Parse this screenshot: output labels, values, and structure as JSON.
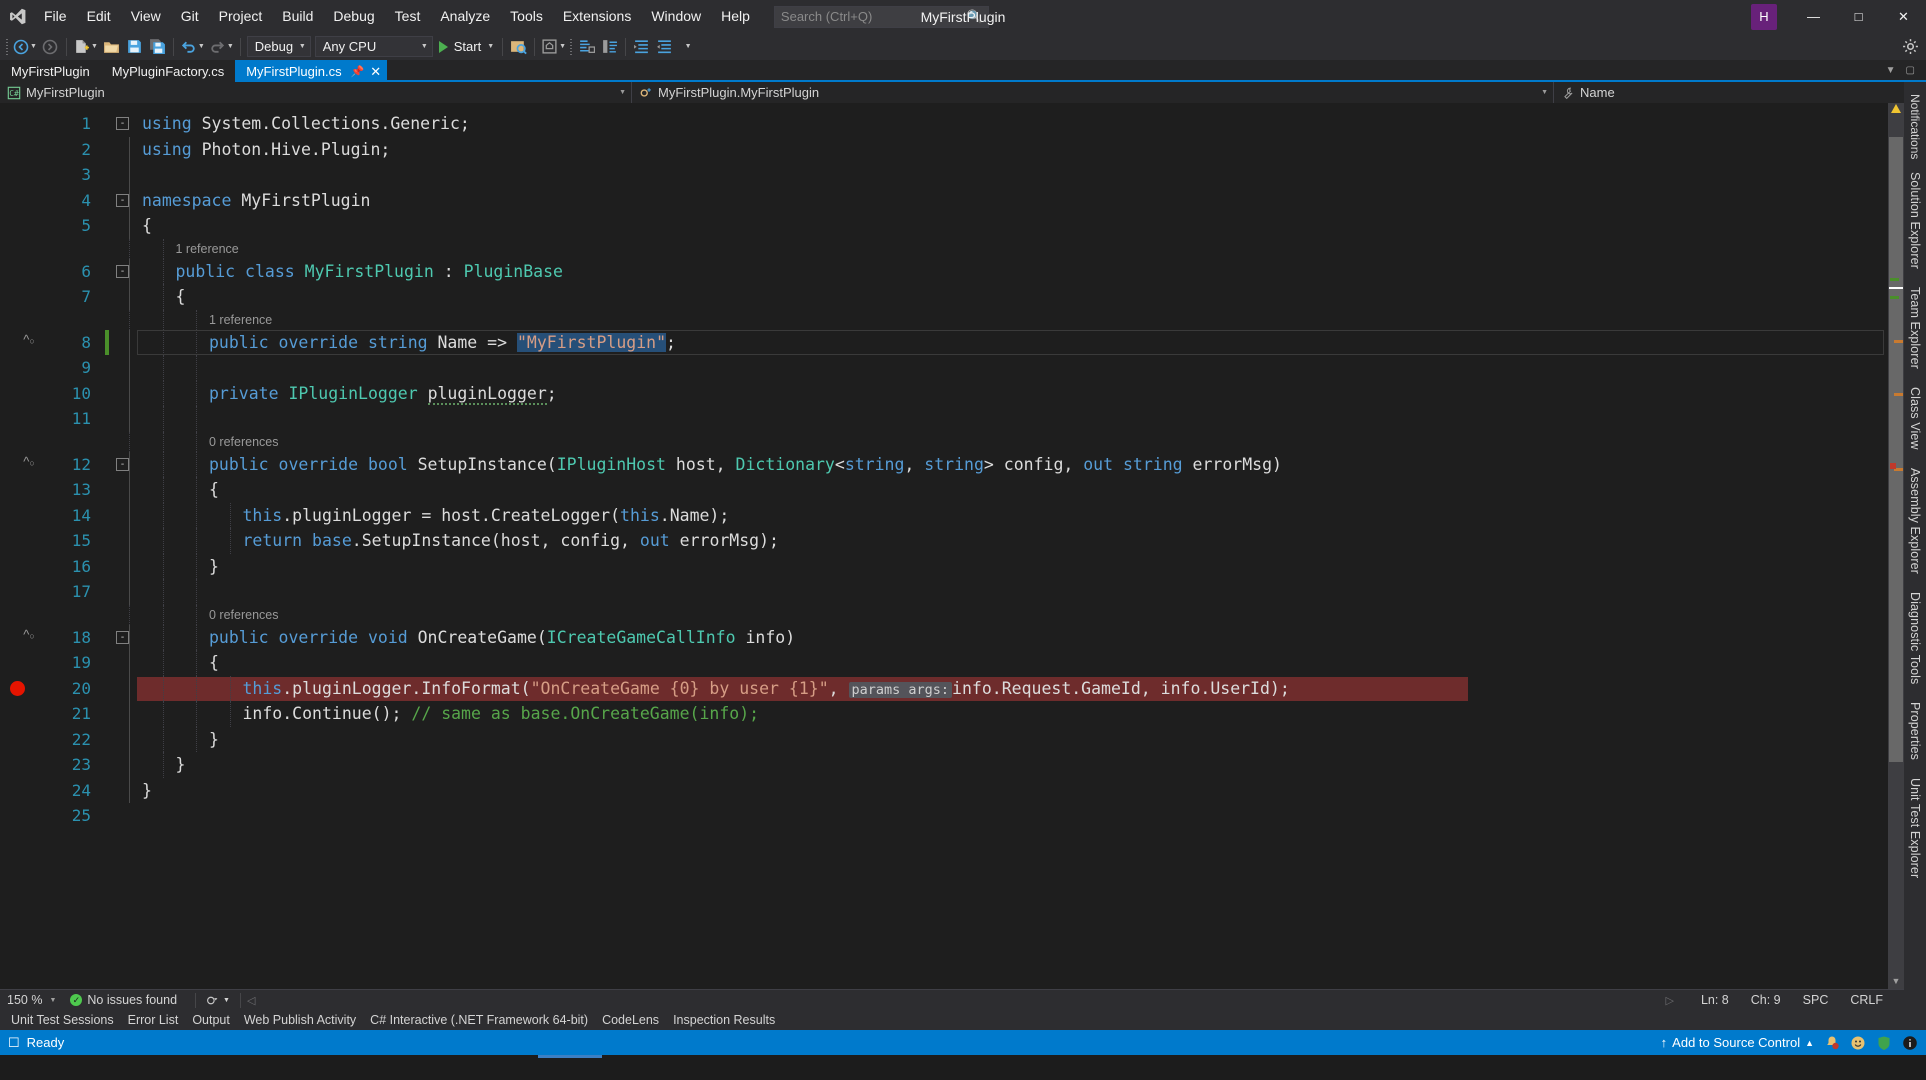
{
  "window": {
    "title": "MyFirstPlugin",
    "logo_icon": "visual-studio-logo",
    "avatar_initial": "H",
    "minimize_icon": "minimize-icon",
    "maximize_icon": "maximize-icon",
    "close_icon": "close-icon"
  },
  "menu": {
    "items": [
      {
        "label": "File"
      },
      {
        "label": "Edit"
      },
      {
        "label": "View"
      },
      {
        "label": "Git"
      },
      {
        "label": "Project"
      },
      {
        "label": "Build"
      },
      {
        "label": "Debug"
      },
      {
        "label": "Test"
      },
      {
        "label": "Analyze"
      },
      {
        "label": "Tools"
      },
      {
        "label": "Extensions"
      },
      {
        "label": "Window"
      },
      {
        "label": "Help"
      }
    ]
  },
  "search": {
    "placeholder": "Search (Ctrl+Q)",
    "value": "",
    "icon": "search-icon"
  },
  "toolbar": {
    "back_icon": "navigate-back-icon",
    "forward_icon": "navigate-forward-icon",
    "new_project_icon": "new-project-icon",
    "open_icon": "open-file-icon",
    "save_icon": "save-icon",
    "save_all_icon": "save-all-icon",
    "undo_icon": "undo-icon",
    "redo_icon": "redo-icon",
    "config_value": "Debug",
    "platform_value": "Any CPU",
    "start_label": "Start",
    "start_icon": "play-icon",
    "preview_icon": "preview-selected-items-icon",
    "live_share_icon": "live-share-icon",
    "selection_icon": "selection-icon",
    "comment_icon": "comment-icon",
    "uncomment_icon": "uncomment-icon",
    "indent_icon": "increase-indent-icon",
    "outdent_icon": "decrease-indent-icon",
    "overflow_icon": "toolbar-overflow-icon",
    "settings_icon": "quick-launch-settings-icon"
  },
  "tabs": {
    "items": [
      {
        "label": "MyFirstPlugin",
        "active": false
      },
      {
        "label": "MyPluginFactory.cs",
        "active": false
      },
      {
        "label": "MyFirstPlugin.cs",
        "active": true
      }
    ],
    "pin_icon": "pin-icon",
    "close_icon": "close-tab-icon",
    "overflow_icon": "tab-overflow-icon",
    "float_icon": "tab-float-icon"
  },
  "breadcrumb": {
    "project": "MyFirstPlugin",
    "project_icon": "csharp-file-icon",
    "type": "MyFirstPlugin.MyFirstPlugin",
    "type_icon": "class-icon",
    "member": "Name",
    "member_icon": "property-icon",
    "dropdown_icon": "chevron-down-icon"
  },
  "editor": {
    "lines": [
      {
        "n": "1",
        "fold": "-",
        "indent": 0,
        "glyph": "",
        "tokens": [
          {
            "t": "using ",
            "c": "kw"
          },
          {
            "t": "System.Collections.Generic;",
            "c": "pln"
          }
        ]
      },
      {
        "n": "2",
        "fold": "",
        "indent": 0,
        "glyph": "",
        "tokens": [
          {
            "t": "using ",
            "c": "kw"
          },
          {
            "t": "Photon.Hive.Plugin;",
            "c": "pln"
          }
        ]
      },
      {
        "n": "3",
        "fold": "",
        "indent": 0,
        "glyph": "",
        "tokens": []
      },
      {
        "n": "4",
        "fold": "-",
        "indent": 0,
        "glyph": "",
        "tokens": [
          {
            "t": "namespace ",
            "c": "kw"
          },
          {
            "t": "MyFirstPlugin",
            "c": "pln"
          }
        ]
      },
      {
        "n": "5",
        "fold": "",
        "indent": 0,
        "glyph": "",
        "tokens": [
          {
            "t": "{",
            "c": "pln"
          }
        ]
      },
      {
        "n": "6",
        "fold": "-",
        "indent": 1,
        "glyph": "",
        "codelens": "1 reference",
        "tokens": [
          {
            "t": "public ",
            "c": "kw"
          },
          {
            "t": "class ",
            "c": "kw"
          },
          {
            "t": "MyFirstPlugin",
            "c": "typ"
          },
          {
            "t": " : ",
            "c": "pln"
          },
          {
            "t": "PluginBase",
            "c": "typ"
          }
        ]
      },
      {
        "n": "7",
        "fold": "",
        "indent": 1,
        "glyph": "",
        "tokens": [
          {
            "t": "{",
            "c": "pln"
          }
        ]
      },
      {
        "n": "8",
        "fold": "",
        "indent": 2,
        "glyph": "inheritance-icon",
        "change": "#4a8f2a",
        "codelens": "1 reference",
        "current": true,
        "tokens": [
          {
            "t": "public ",
            "c": "kw"
          },
          {
            "t": "override ",
            "c": "kw"
          },
          {
            "t": "string ",
            "c": "kw"
          },
          {
            "t": "Name",
            "c": "pln"
          },
          {
            "t": " => ",
            "c": "pln"
          },
          {
            "t": "\"MyFirstPlugin\"",
            "c": "str sel"
          },
          {
            "t": ";",
            "c": "pln"
          }
        ]
      },
      {
        "n": "9",
        "fold": "",
        "indent": 2,
        "glyph": "",
        "tokens": []
      },
      {
        "n": "10",
        "fold": "",
        "indent": 2,
        "glyph": "",
        "tokens": [
          {
            "t": "private ",
            "c": "kw"
          },
          {
            "t": "IPluginLogger ",
            "c": "typ"
          },
          {
            "t": "pluginLogger",
            "c": "pln sq"
          },
          {
            "t": ";",
            "c": "pln"
          }
        ]
      },
      {
        "n": "11",
        "fold": "",
        "indent": 2,
        "glyph": "",
        "tokens": []
      },
      {
        "n": "12",
        "fold": "-",
        "indent": 2,
        "glyph": "inheritance-icon",
        "codelens": "0 references",
        "tokens": [
          {
            "t": "public ",
            "c": "kw"
          },
          {
            "t": "override ",
            "c": "kw"
          },
          {
            "t": "bool ",
            "c": "kw"
          },
          {
            "t": "SetupInstance",
            "c": "pln"
          },
          {
            "t": "(",
            "c": "pln"
          },
          {
            "t": "IPluginHost",
            "c": "typ"
          },
          {
            "t": " host, ",
            "c": "pln"
          },
          {
            "t": "Dictionary",
            "c": "typ"
          },
          {
            "t": "<",
            "c": "pln"
          },
          {
            "t": "string",
            "c": "kw"
          },
          {
            "t": ", ",
            "c": "pln"
          },
          {
            "t": "string",
            "c": "kw"
          },
          {
            "t": "> config, ",
            "c": "pln"
          },
          {
            "t": "out ",
            "c": "kw"
          },
          {
            "t": "string ",
            "c": "kw"
          },
          {
            "t": "errorMsg)",
            "c": "pln"
          }
        ]
      },
      {
        "n": "13",
        "fold": "",
        "indent": 2,
        "glyph": "",
        "tokens": [
          {
            "t": "{",
            "c": "pln"
          }
        ]
      },
      {
        "n": "14",
        "fold": "",
        "indent": 3,
        "glyph": "",
        "tokens": [
          {
            "t": "this",
            "c": "kw"
          },
          {
            "t": ".pluginLogger = host.CreateLogger(",
            "c": "pln"
          },
          {
            "t": "this",
            "c": "kw"
          },
          {
            "t": ".Name);",
            "c": "pln"
          }
        ]
      },
      {
        "n": "15",
        "fold": "",
        "indent": 3,
        "glyph": "",
        "tokens": [
          {
            "t": "return ",
            "c": "kw"
          },
          {
            "t": "base",
            "c": "kw"
          },
          {
            "t": ".SetupInstance(host, config, ",
            "c": "pln"
          },
          {
            "t": "out ",
            "c": "kw"
          },
          {
            "t": "errorMsg);",
            "c": "pln"
          }
        ]
      },
      {
        "n": "16",
        "fold": "",
        "indent": 2,
        "glyph": "",
        "tokens": [
          {
            "t": "}",
            "c": "pln"
          }
        ]
      },
      {
        "n": "17",
        "fold": "",
        "indent": 2,
        "glyph": "",
        "tokens": []
      },
      {
        "n": "18",
        "fold": "-",
        "indent": 2,
        "glyph": "inheritance-icon",
        "codelens": "0 references",
        "tokens": [
          {
            "t": "public ",
            "c": "kw"
          },
          {
            "t": "override ",
            "c": "kw"
          },
          {
            "t": "void ",
            "c": "kw"
          },
          {
            "t": "OnCreateGame",
            "c": "pln"
          },
          {
            "t": "(",
            "c": "pln"
          },
          {
            "t": "ICreateGameCallInfo",
            "c": "typ"
          },
          {
            "t": " info)",
            "c": "pln"
          }
        ]
      },
      {
        "n": "19",
        "fold": "",
        "indent": 2,
        "glyph": "",
        "tokens": [
          {
            "t": "{",
            "c": "pln"
          }
        ]
      },
      {
        "n": "20",
        "fold": "",
        "indent": 3,
        "glyph": "breakpoint-icon",
        "error": true,
        "tokens": [
          {
            "t": "this",
            "c": "kw"
          },
          {
            "t": ".pluginLogger.InfoFormat(",
            "c": "pln"
          },
          {
            "t": "\"OnCreateGame {0} by user {1}\"",
            "c": "str"
          },
          {
            "t": ", ",
            "c": "pln"
          },
          {
            "t": "params args:",
            "c": "hint"
          },
          {
            "t": "info.Request.GameId, info.UserId);",
            "c": "pln"
          }
        ]
      },
      {
        "n": "21",
        "fold": "",
        "indent": 3,
        "glyph": "",
        "tokens": [
          {
            "t": "info.Continue(); ",
            "c": "pln"
          },
          {
            "t": "// same as base.OnCreateGame(info);",
            "c": "cmt"
          }
        ]
      },
      {
        "n": "22",
        "fold": "",
        "indent": 2,
        "glyph": "",
        "tokens": [
          {
            "t": "}",
            "c": "pln"
          }
        ]
      },
      {
        "n": "23",
        "fold": "",
        "indent": 1,
        "glyph": "",
        "tokens": [
          {
            "t": "}",
            "c": "pln"
          }
        ]
      },
      {
        "n": "24",
        "fold": "",
        "indent": 0,
        "glyph": "",
        "tokens": [
          {
            "t": "}",
            "c": "pln"
          }
        ]
      },
      {
        "n": "25",
        "fold": "",
        "indent": 0,
        "glyph": "",
        "tokens": []
      }
    ]
  },
  "right_tool_tabs": {
    "notifications_icon": "notifications-icon",
    "items": [
      {
        "label": "Solution Explorer"
      },
      {
        "label": "Team Explorer"
      },
      {
        "label": "Class View"
      },
      {
        "label": "Assembly Explorer"
      },
      {
        "label": "Diagnostic Tools"
      },
      {
        "label": "Properties"
      },
      {
        "label": "Unit Test Explorer"
      }
    ]
  },
  "editor_status": {
    "zoom": "150 %",
    "issues": "No issues found",
    "issues_icon": "check-circle-icon",
    "issues_filter_icon": "issue-filter-icon",
    "line": "Ln: 8",
    "col": "Ch: 9",
    "spaces": "SPC",
    "line_ending": "CRLF"
  },
  "dock_tabs": {
    "items": [
      {
        "label": "Unit Test Sessions"
      },
      {
        "label": "Error List"
      },
      {
        "label": "Output"
      },
      {
        "label": "Web Publish Activity"
      },
      {
        "label": "C# Interactive (.NET Framework 64-bit)"
      },
      {
        "label": "CodeLens"
      },
      {
        "label": "Inspection Results"
      }
    ]
  },
  "status_bar": {
    "ready": "Ready",
    "ready_icon": "ready-icon",
    "source_control": "Add to Source Control",
    "source_control_icon": "upload-arrow-icon",
    "source_control_caret": "chevron-up-icon",
    "notify_icon": "notification-bell-icon",
    "feedback_icon": "feedback-smiley-icon",
    "shield_icon": "shield-icon",
    "info_icon": "info-icon",
    "accent_color": "#007acc"
  },
  "colors": {
    "accent": "#007acc",
    "editor_bg": "#1e1e1e",
    "chrome_bg": "#2d2d30",
    "tab_bg": "#252526",
    "keyword": "#569cd6",
    "type": "#4ec9b0",
    "string": "#d69d85",
    "comment": "#57a64a",
    "linenum": "#2b91af",
    "selection": "#264f78",
    "error_line": "#6e2c2c",
    "breakpoint": "#e51400",
    "change_bar": "#4a8f2a"
  }
}
